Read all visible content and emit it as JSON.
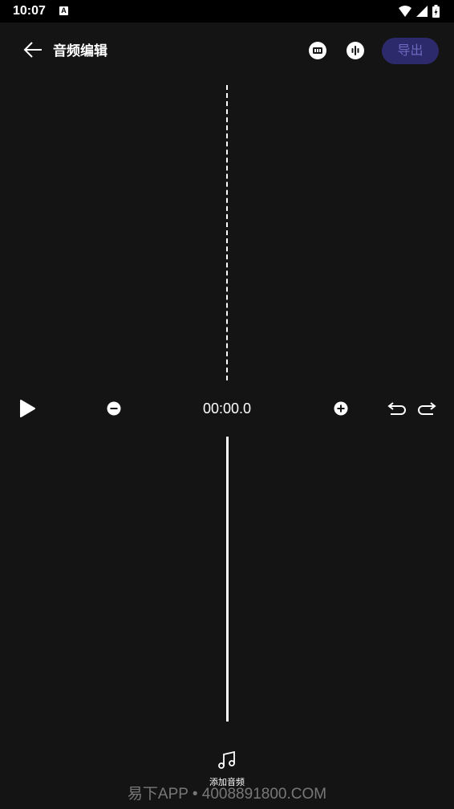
{
  "status_bar": {
    "time": "10:07",
    "notification_badge": "A"
  },
  "header": {
    "title": "音频编辑",
    "export_label": "导出"
  },
  "controls": {
    "time": "00:00.0"
  },
  "add_audio": {
    "label": "添加音频"
  },
  "watermark": {
    "text": "易下APP • 4008891800.COM"
  },
  "colors": {
    "background": "#141414",
    "export_bg": "#2c2a6a",
    "export_text": "#6b6ac0"
  },
  "icons": [
    "back-arrow-icon",
    "caption-icon",
    "waveform-icon",
    "play-icon",
    "zoom-out-icon",
    "zoom-in-icon",
    "undo-icon",
    "redo-icon",
    "music-note-icon"
  ]
}
